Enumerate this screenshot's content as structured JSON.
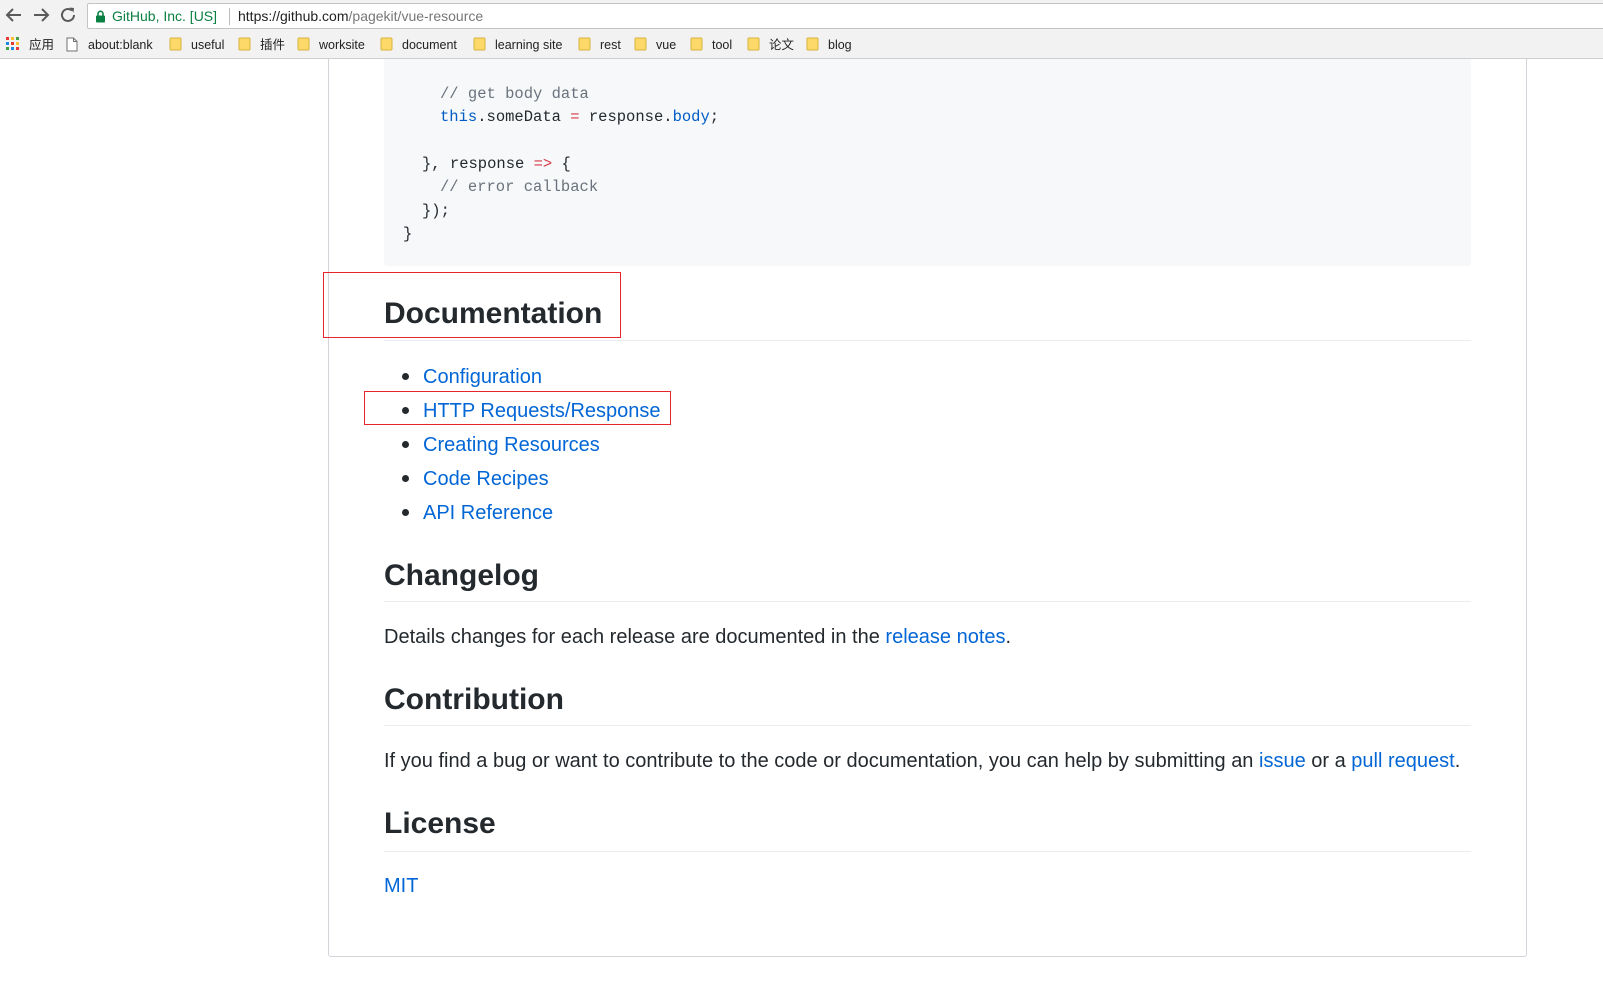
{
  "browser": {
    "nav": {
      "back": "back-arrow-icon",
      "forward": "forward-arrow-icon",
      "reload": "reload-icon"
    },
    "omnibox": {
      "org_name": "GitHub, Inc. [US]",
      "url_host": "https://github.com",
      "url_path": "/pagekit/vue-resource",
      "lock_color": "#0b8043"
    },
    "bookmarks": [
      {
        "label": "应用",
        "icon": "apps-grid-icon"
      },
      {
        "label": "about:blank",
        "icon": "page-icon"
      },
      {
        "label": "useful",
        "icon": "folder-icon"
      },
      {
        "label": "插件",
        "icon": "folder-icon"
      },
      {
        "label": "worksite",
        "icon": "folder-icon"
      },
      {
        "label": "document",
        "icon": "folder-icon"
      },
      {
        "label": "learning site",
        "icon": "folder-icon"
      },
      {
        "label": "rest",
        "icon": "folder-icon"
      },
      {
        "label": "vue",
        "icon": "folder-icon"
      },
      {
        "label": "tool",
        "icon": "folder-icon"
      },
      {
        "label": "论文",
        "icon": "folder-icon"
      },
      {
        "label": "blog",
        "icon": "folder-icon"
      }
    ]
  },
  "code": {
    "line1_comment": "// get body data",
    "line2_this": "this",
    "line2_mid": ".someData ",
    "line2_eq": "=",
    "line2_resp": " response.",
    "line2_body": "body",
    "line2_end": ";",
    "line3_start": "}, response ",
    "line3_arrow": "=>",
    "line3_end": " {",
    "line4_comment": "// error callback",
    "line5": "});",
    "line6": "}"
  },
  "sections": {
    "documentation": {
      "title": "Documentation",
      "links": [
        "Configuration",
        "HTTP Requests/Response",
        "Creating Resources",
        "Code Recipes",
        "API Reference"
      ]
    },
    "changelog": {
      "title": "Changelog",
      "text_before": "Details changes for each release are documented in the ",
      "link": "release notes",
      "text_after": "."
    },
    "contribution": {
      "title": "Contribution",
      "text_before": "If you find a bug or want to contribute to the code or documentation, you can help by submitting an ",
      "link1": "issue",
      "text_middle": " or a ",
      "link2": "pull request",
      "text_after": "."
    },
    "license": {
      "title": "License",
      "link": "MIT"
    }
  },
  "colors": {
    "link": "#0366d6",
    "annotation": "#e8232c",
    "code_bg": "#f6f8fa"
  }
}
